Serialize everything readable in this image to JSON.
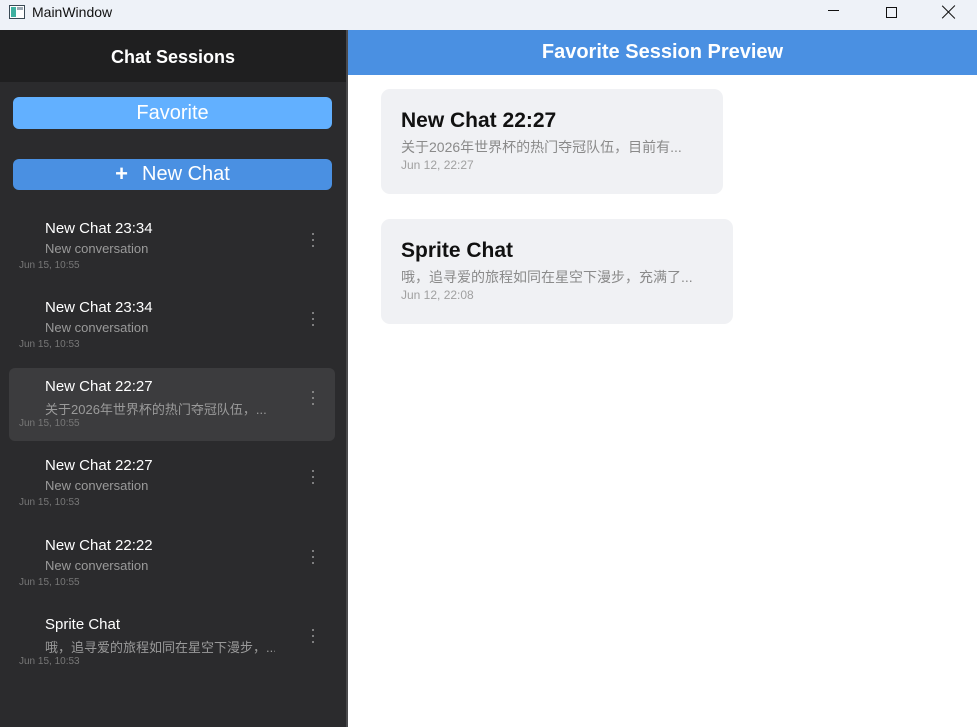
{
  "window": {
    "title": "MainWindow"
  },
  "sidebar": {
    "title": "Chat Sessions",
    "favorite_label": "Favorite",
    "new_chat_icon": "+",
    "new_chat_label": "New Chat",
    "sessions": [
      {
        "title": "New Chat 23:34",
        "preview": "New conversation",
        "date": "Jun 15, 10:55",
        "selected": false
      },
      {
        "title": "New Chat 23:34",
        "preview": "New conversation",
        "date": "Jun 15, 10:53",
        "selected": false
      },
      {
        "title": "New Chat 22:27",
        "preview": "关于2026年世界杯的热门夺冠队伍，...",
        "date": "Jun 15, 10:55",
        "selected": true
      },
      {
        "title": "New Chat 22:27",
        "preview": "New conversation",
        "date": "Jun 15, 10:53",
        "selected": false
      },
      {
        "title": "New Chat 22:22",
        "preview": "New conversation",
        "date": "Jun 15, 10:55",
        "selected": false
      },
      {
        "title": "Sprite Chat",
        "preview": "哦，追寻爱的旅程如同在星空下漫步，...",
        "date": "Jun 15, 10:53",
        "selected": false
      }
    ]
  },
  "main": {
    "title": "Favorite Session Preview",
    "favorites": [
      {
        "title": "New Chat 22:27",
        "preview": "关于2026年世界杯的热门夺冠队伍，目前有...",
        "date": "Jun 12, 22:27"
      },
      {
        "title": "Sprite Chat",
        "preview": "哦，追寻爱的旅程如同在星空下漫步，充满了...",
        "date": "Jun 12, 22:08"
      }
    ]
  },
  "colors": {
    "sidebar_bg": "#2b2b2d",
    "favorite_button": "#62b0ff",
    "new_chat_button": "#4a90e2",
    "header_accent": "#4a90e2",
    "card_bg": "#f0f1f4"
  }
}
